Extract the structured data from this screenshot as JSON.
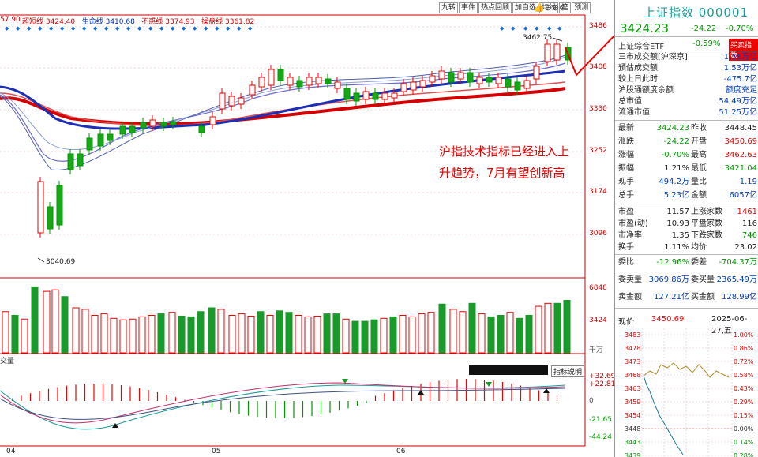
{
  "ma_bar": {
    "first_value": "57.90",
    "items": [
      {
        "label": "超短线",
        "value": "3424.40",
        "color": "#d40000"
      },
      {
        "label": "生命线",
        "value": "3410.68",
        "color": "#0030c0"
      },
      {
        "label": "不惑线",
        "value": "3374.93",
        "color": "#d40000"
      },
      {
        "label": "操盘线",
        "value": "3361.82",
        "color": "#d40000"
      }
    ]
  },
  "toolbar": {
    "buttons": [
      "九转",
      "事件",
      "热点回顾",
      "加自选",
      "均线",
      "笔",
      "预测"
    ]
  },
  "price_axis": [
    "3486",
    "3408",
    "3330",
    "3252",
    "3174",
    "3096"
  ],
  "annotations": {
    "high_label": "3462.75",
    "low_label": "3040.69"
  },
  "callout": {
    "line1": "沪指技术指标已经进入上",
    "line2": "升趋势，7月有望创新高"
  },
  "volume_axis": {
    "top": "6848",
    "mid": "3424",
    "unit": "千万"
  },
  "indicator_bar": {
    "title": "交量",
    "tag": "指标说明",
    "axis": [
      "+32.69",
      "+22.81",
      "0",
      "-21.65",
      "-44.24"
    ]
  },
  "x_labels": [
    "04",
    "05",
    "06"
  ],
  "panel": {
    "title": "上证指数 000001",
    "price": "3424.23",
    "change": "-24.22",
    "change_pct": "-0.70%",
    "etf_name": "上证综合ETF",
    "etf_pct": "-0.59%",
    "etf_button": "买卖指数",
    "info_rows": [
      {
        "k": "三市成交额[沪深京]",
        "v": "1.58万亿",
        "cls": "blue"
      },
      {
        "k": "预估成交额",
        "v": "1.53万亿",
        "cls": "blue"
      },
      {
        "k": "较上日此时",
        "v": "-475.7亿",
        "cls": "blue"
      },
      {
        "k": "沪股通额度余额",
        "v": "额度充足",
        "cls": "blue"
      },
      {
        "k": "总市值",
        "v": "54.49万亿",
        "cls": "blue"
      },
      {
        "k": "流通市值",
        "v": "51.25万亿",
        "cls": "blue"
      }
    ],
    "quote_rows": [
      {
        "a": "最新",
        "av": "3424.23",
        "avc": "green",
        "b": "昨收",
        "bv": "3448.45",
        "bvc": ""
      },
      {
        "a": "涨跌",
        "av": "-24.22",
        "avc": "green",
        "b": "开盘",
        "bv": "3450.69",
        "bvc": "red"
      },
      {
        "a": "涨幅",
        "av": "-0.70%",
        "avc": "green",
        "b": "最高",
        "bv": "3462.63",
        "bvc": "red"
      },
      {
        "a": "振幅",
        "av": "1.21%",
        "avc": "",
        "b": "最低",
        "bv": "3421.04",
        "bvc": "green"
      },
      {
        "a": "现手",
        "av": "494.2万",
        "avc": "blue",
        "b": "量比",
        "bv": "1.19",
        "bvc": "blue"
      },
      {
        "a": "总手",
        "av": "5.23亿",
        "avc": "blue",
        "b": "金额",
        "bv": "6057亿",
        "bvc": "blue"
      }
    ],
    "stat_rows": [
      {
        "a": "市盈",
        "av": "11.57",
        "b": "上涨家数",
        "bv": "1461",
        "bvc": "red"
      },
      {
        "a": "市盈(动)",
        "av": "10.93",
        "b": "平盘家数",
        "bv": "116",
        "bvc": ""
      },
      {
        "a": "市净率",
        "av": "1.35",
        "b": "下跌家数",
        "bv": "746",
        "bvc": "green"
      },
      {
        "a": "换手",
        "av": "1.11%",
        "b": "均价",
        "bv": "23.02",
        "bvc": ""
      }
    ],
    "wei": {
      "a": "委比",
      "av": "-12.96%",
      "b": "委差",
      "bv": "-704.37万"
    },
    "maimai": [
      {
        "a": "委卖量",
        "av": "3069.86万",
        "b": "委买量",
        "bv": "2365.49万"
      },
      {
        "a": "卖金额",
        "av": "127.21亿",
        "b": "买金额",
        "bv": "128.99亿"
      }
    ],
    "mini": {
      "current_label": "现价",
      "current": "3450.69",
      "date": "2025-06-27,五",
      "left_axis": [
        "3483",
        "3478",
        "3473",
        "3468",
        "3463",
        "3459",
        "3454",
        "3448",
        "3443",
        "3439"
      ],
      "right_axis": [
        "1.00%",
        "0.86%",
        "0.72%",
        "0.58%",
        "0.43%",
        "0.29%",
        "0.15%",
        "0.00%",
        "0.14%",
        "0.28%"
      ]
    }
  }
}
